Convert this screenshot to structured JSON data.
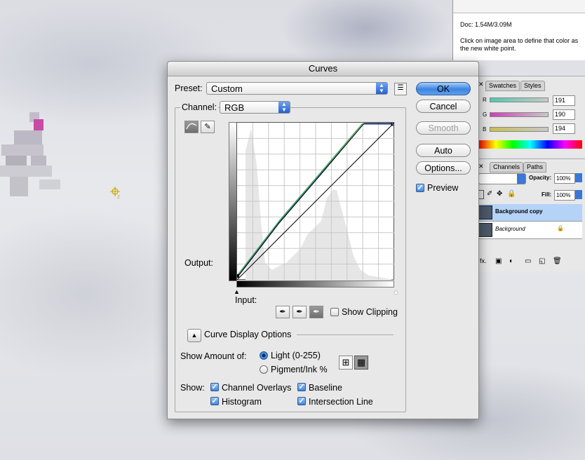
{
  "colors": {
    "accent": "#2f6fd6",
    "panel": "#e8e8e8"
  },
  "info": {
    "doc": "Doc: 1.54M/3.09M",
    "hint": "Click on image area to define that color as the new white point."
  },
  "color_panel": {
    "tabs": [
      "Swatches",
      "Styles"
    ],
    "sliders": [
      {
        "label": "R",
        "value": "191"
      },
      {
        "label": "G",
        "value": "190"
      },
      {
        "label": "B",
        "value": "194"
      }
    ]
  },
  "layers_panel": {
    "tabs": [
      "Channels",
      "Paths"
    ],
    "opacity_label": "Opacity:",
    "opacity_value": "100%",
    "fill_label": "Fill:",
    "fill_value": "100%",
    "layers": [
      {
        "name": "Background copy",
        "selected": true
      },
      {
        "name": "Background",
        "locked": true
      }
    ]
  },
  "dialog": {
    "title": "Curves",
    "preset_label": "Preset:",
    "preset_value": "Custom",
    "channel_label": "Channel:",
    "channel_value": "RGB",
    "output_label": "Output:",
    "input_label": "Input:",
    "show_clipping": "Show Clipping",
    "buttons": {
      "ok": "OK",
      "cancel": "Cancel",
      "smooth": "Smooth",
      "auto": "Auto",
      "options": "Options..."
    },
    "preview": "Preview",
    "curve_display_options": "Curve Display Options",
    "show_amount_label": "Show Amount of:",
    "light": "Light  (0-255)",
    "pigment": "Pigment/Ink %",
    "show_label": "Show:",
    "channel_overlays": "Channel Overlays",
    "baseline": "Baseline",
    "histogram": "Histogram",
    "intersection_line": "Intersection Line"
  }
}
